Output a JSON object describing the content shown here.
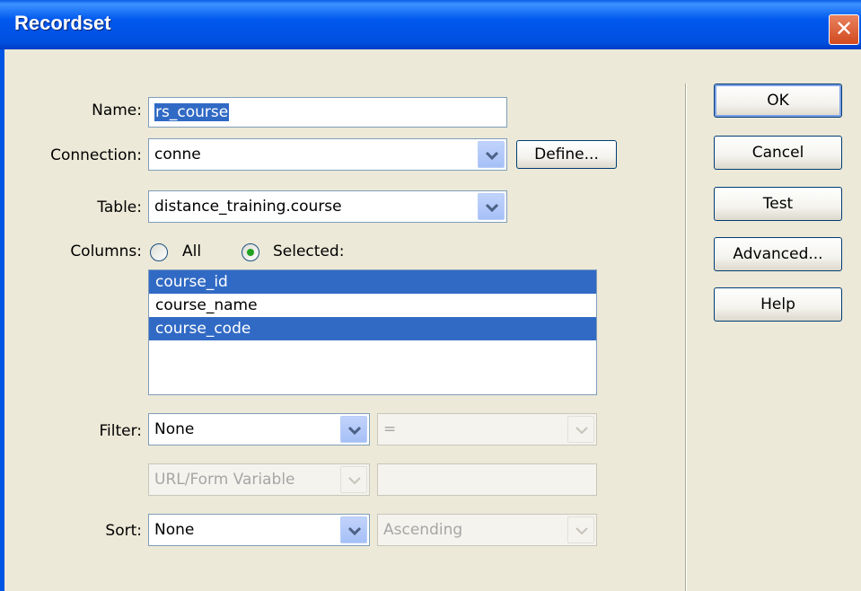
{
  "window": {
    "title": "Recordset",
    "close_glyph": "✕"
  },
  "form": {
    "name_label": "Name:",
    "name_value": "rs_course",
    "connection_label": "Connection:",
    "connection_value": "conne",
    "define_button": "Define...",
    "table_label": "Table:",
    "table_value": "distance_training.course",
    "columns_label": "Columns:",
    "columns_all": "All",
    "columns_selected": "Selected:",
    "columns_mode": "Selected",
    "columns_list": [
      {
        "label": "course_id",
        "selected": true
      },
      {
        "label": "course_name",
        "selected": false
      },
      {
        "label": "course_code",
        "selected": true
      }
    ],
    "filter_label": "Filter:",
    "filter_column": "None",
    "filter_operator": "=",
    "filter_source": "URL/Form Variable",
    "filter_value": "",
    "sort_label": "Sort:",
    "sort_column": "None",
    "sort_order": "Ascending"
  },
  "buttons": {
    "ok": "OK",
    "cancel": "Cancel",
    "test": "Test",
    "advanced": "Advanced...",
    "help": "Help"
  },
  "icons": {
    "close": "close-icon",
    "dropdown": "chevron-down-icon"
  },
  "colors": {
    "title_bar": "#0058ee",
    "selection": "#316ac5",
    "dialog_bg": "#ece9d8",
    "radio_dot": "#21a121"
  }
}
